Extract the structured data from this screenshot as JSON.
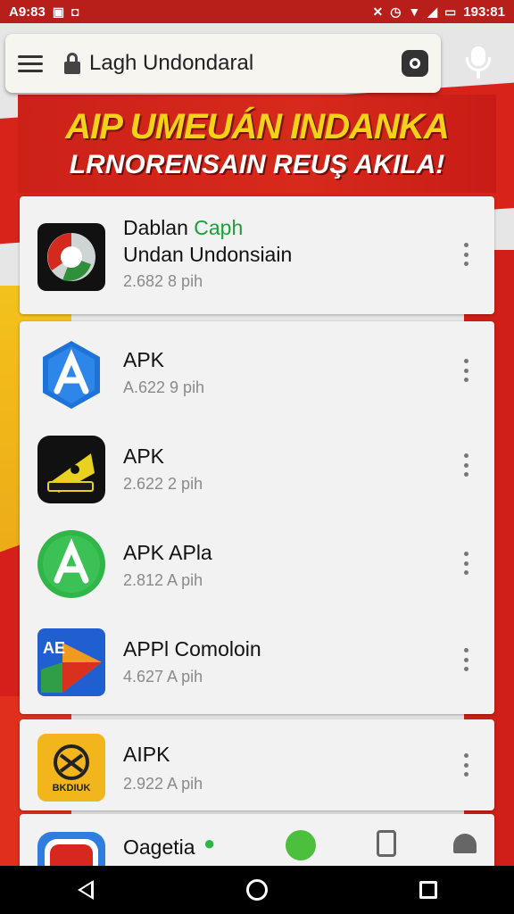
{
  "status_bar": {
    "time_left": "A9:83",
    "time_right": "193:81"
  },
  "search": {
    "query": "Lagh Undondaral"
  },
  "banner": {
    "line1": "AIP UMEUÁN INDANKA",
    "line2": "LRNORENSAIN REUŞ AKILA!"
  },
  "featured": {
    "title_part1": "Dablan ",
    "title_part2": "Caph",
    "title_line2": "Undan Undonsiain",
    "subtitle": "2.682 8 pih"
  },
  "apps": [
    {
      "title": "APK",
      "subtitle": "A.622 9 pih"
    },
    {
      "title": "APK",
      "subtitle": "2.622 2 pih"
    },
    {
      "title": "APK APla",
      "subtitle": "2.812 A pih"
    },
    {
      "title": "APPl Comoloin",
      "subtitle": "4.627 A pih"
    }
  ],
  "single_app": {
    "title": "AIPK",
    "subtitle": "2.922 A pih",
    "icon_label": "BKDIUK"
  },
  "partial_app": {
    "title": "Oagetia"
  },
  "icons": {
    "menu": "hamburger-menu-icon",
    "lock": "lock-icon",
    "shield": "shield-icon",
    "mic": "microphone-icon",
    "more": "more-vertical-icon"
  },
  "colors": {
    "status_bar": "#b81f1a",
    "banner_red": "#cc2119",
    "banner_yellow": "#f4d21a",
    "accent_green": "#1e9e3a"
  }
}
